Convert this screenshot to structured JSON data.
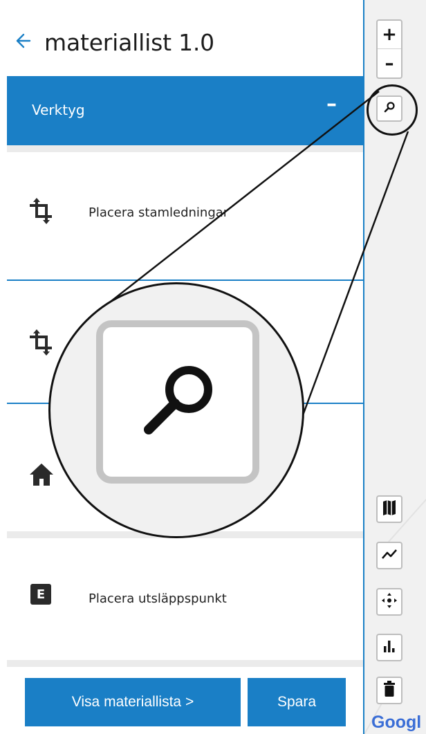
{
  "header": {
    "back_icon": "arrow-left-icon",
    "title": "materiallist 1.0"
  },
  "tools_panel": {
    "label": "Verktyg",
    "collapse_symbol": "–"
  },
  "tool_items": [
    {
      "label": "Placera stamledningar",
      "icon": "crop-rotate-icon"
    },
    {
      "label": "",
      "icon": "crop-rotate-icon"
    },
    {
      "label": "",
      "icon": "home-icon"
    },
    {
      "label": "Placera utsläppspunkt",
      "icon": "letter-e-icon",
      "icon_text": "E"
    }
  ],
  "footer": {
    "show_list_label": "Visa materiallista >",
    "save_label": "Spara"
  },
  "map_controls": {
    "zoom_in": "+",
    "zoom_out": "–",
    "search_icon": "search-icon",
    "buttons": [
      "map-icon",
      "line-chart-icon",
      "move-icon",
      "bar-chart-icon",
      "trash-icon"
    ],
    "logo_text": "Googl"
  },
  "colors": {
    "accent": "#1a7fc6",
    "separator": "#ebebeb",
    "map_background": "#f1f1f1"
  }
}
